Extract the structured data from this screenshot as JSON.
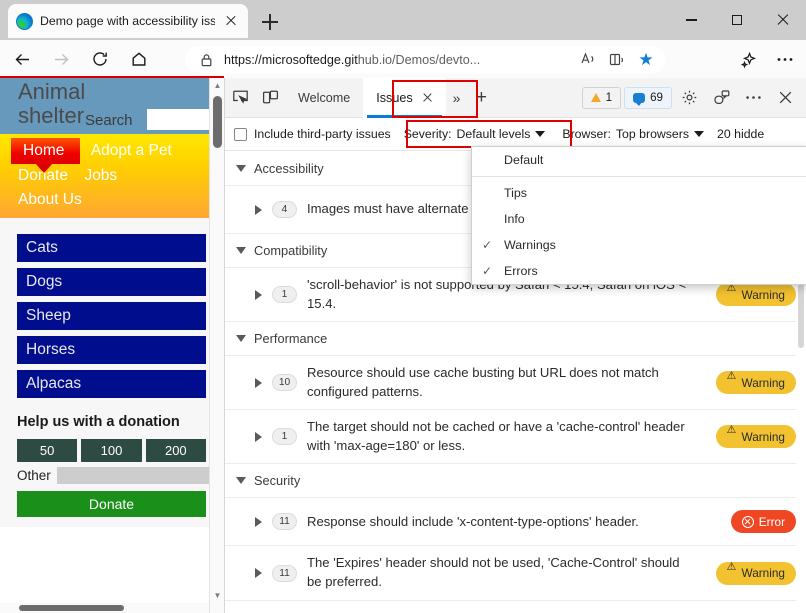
{
  "browser": {
    "tab": {
      "title": "Demo page with accessibility iss",
      "favicon": "edge-logo",
      "close": "×"
    },
    "newtab_label": "+",
    "window_controls": {
      "minimize": "—",
      "maximize": "□",
      "close": "✕"
    },
    "nav": {
      "back": "←",
      "forward": "→",
      "refresh": "↻",
      "home": "⌂"
    },
    "omnibox": {
      "url_bold": "https://microsoftedge.git",
      "url_dim": "hub.io/Demos/devto...",
      "full_url": "https://microsoftedge.github.io/Demos/devto...",
      "icons": [
        "lock-icon",
        "read-aloud-icon",
        "immersive-reader-icon",
        "favorite-star-icon"
      ]
    },
    "toolbar_right": {
      "copilot": "copilot-icon",
      "more": "···"
    }
  },
  "page": {
    "logo": "Animal shelter",
    "search_label": "Search",
    "search_value": "",
    "nav_primary": [
      "Home",
      "Adopt a Pet"
    ],
    "nav_secondary": [
      "Donate",
      "Jobs"
    ],
    "nav_tertiary": [
      "About Us"
    ],
    "categories": [
      "Cats",
      "Dogs",
      "Sheep",
      "Horses",
      "Alpacas"
    ],
    "donation": {
      "heading": "Help us with a donation",
      "amounts": [
        "50",
        "100",
        "200"
      ],
      "other_label": "Other",
      "other_value": "",
      "button": "Donate"
    }
  },
  "devtools": {
    "tools": {
      "inspect": "inspect-element-icon",
      "device": "device-emulation-icon"
    },
    "tabs": [
      {
        "label": "Welcome",
        "active": false
      },
      {
        "label": "Issues",
        "active": true,
        "closable": true
      }
    ],
    "more_tabs": "»",
    "add_tab": "+",
    "counters": {
      "warnings": "1",
      "messages": "69"
    },
    "right_buttons": {
      "settings": "gear-icon",
      "feedback": "feedback-icon",
      "more": "···",
      "close": "✕"
    },
    "filter_bar": {
      "third_party_label": "Include third-party issues",
      "third_party_checked": false,
      "severity_label": "Severity:",
      "severity_value": "Default levels",
      "browser_label": "Browser:",
      "browser_value": "Top browsers",
      "hidden_text": "20 hidde"
    },
    "severity_menu": {
      "open": true,
      "items": [
        {
          "label": "Default",
          "checked": false,
          "separator_after": true
        },
        {
          "label": "Tips",
          "checked": false
        },
        {
          "label": "Info",
          "checked": false
        },
        {
          "label": "Warnings",
          "checked": true
        },
        {
          "label": "Errors",
          "checked": true
        }
      ],
      "check_glyph": "✓"
    },
    "groups": [
      {
        "name": "Accessibility",
        "expanded": true,
        "issues": [
          {
            "count": "4",
            "text": "Images must have alternate text attribute",
            "badge": null
          }
        ]
      },
      {
        "name": "Compatibility",
        "expanded": true,
        "issues": [
          {
            "count": "1",
            "text": "'scroll-behavior' is not supported by Safari < 15.4, Safari on iOS < 15.4.",
            "badge": "Warning"
          }
        ]
      },
      {
        "name": "Performance",
        "expanded": true,
        "issues": [
          {
            "count": "10",
            "text": "Resource should use cache busting but URL does not match configured patterns.",
            "badge": "Warning"
          },
          {
            "count": "1",
            "text": "The target should not be cached or have a 'cache-control' header with 'max-age=180' or less.",
            "badge": "Warning"
          }
        ]
      },
      {
        "name": "Security",
        "expanded": true,
        "issues": [
          {
            "count": "11",
            "text": "Response should include 'x-content-type-options' header.",
            "badge": "Error"
          },
          {
            "count": "11",
            "text": "The 'Expires' header should not be used, 'Cache-Control' should be preferred.",
            "badge": "Warning"
          }
        ]
      }
    ],
    "badge_labels": {
      "warning": "Warning",
      "error": "Error"
    }
  },
  "colors": {
    "annotation_red": "#e00000",
    "tab_underline_blue": "#0a7cd4",
    "warning_yellow": "#f2c230",
    "error_red": "#ef4723",
    "page_header_blue": "#6699bb",
    "page_nav_yellow": "#ffd000",
    "category_navy": "#000d8c",
    "donate_green": "#1a8f1a"
  }
}
